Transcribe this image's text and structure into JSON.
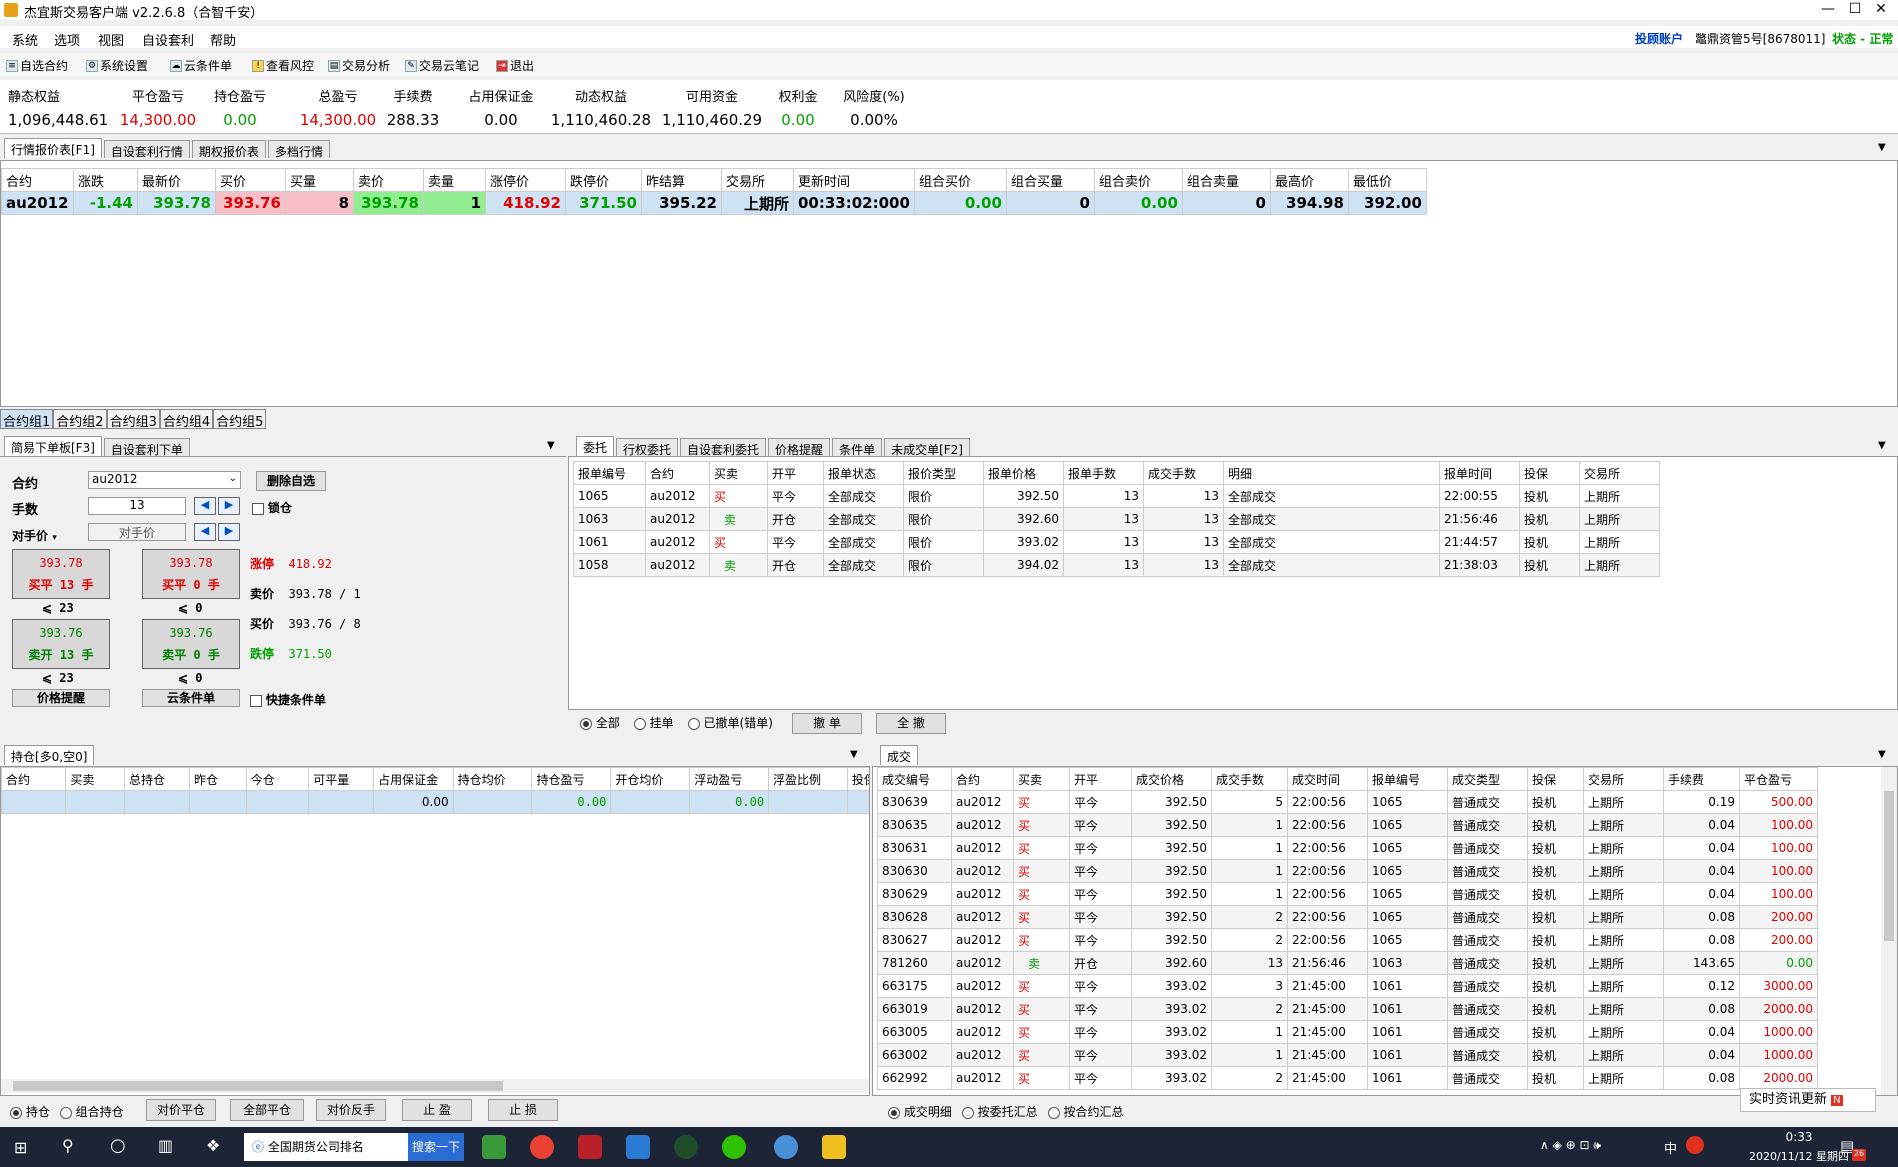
{
  "window": {
    "title": "杰宜斯交易客户端 v2.2.6.8（合智千安）",
    "min": "—",
    "max": "☐",
    "close": "✕"
  },
  "menu": [
    "系统",
    "选项",
    "视图",
    "自设套利",
    "帮助"
  ],
  "account": {
    "type": "投顾账户",
    "name": "鼈鼎资管5号[8678011]",
    "status": "状态 - 正常"
  },
  "toolbar": [
    "自选合约",
    "系统设置",
    "云条件单",
    "查看风控",
    "交易分析",
    "交易云笔记",
    "退出"
  ],
  "summary": [
    {
      "label": "静态权益",
      "value": "1,096,448.61",
      "color": "#000000"
    },
    {
      "label": "平仓盈亏",
      "value": "14,300.00",
      "color": "#e00000"
    },
    {
      "label": "持仓盈亏",
      "value": "0.00",
      "color": "#00a000"
    },
    {
      "label": "总盈亏",
      "value": "14,300.00",
      "color": "#e00000"
    },
    {
      "label": "手续费",
      "value": "288.33",
      "color": "#000000"
    },
    {
      "label": "占用保证金",
      "value": "0.00",
      "color": "#000000"
    },
    {
      "label": "动态权益",
      "value": "1,110,460.28",
      "color": "#000000"
    },
    {
      "label": "可用资金",
      "value": "1,110,460.29",
      "color": "#000000"
    },
    {
      "label": "权利金",
      "value": "0.00",
      "color": "#00a000"
    },
    {
      "label": "风险度(%)",
      "value": "0.00%",
      "color": "#000000"
    }
  ],
  "quote_tabs": [
    "行情报价表[F1]",
    "自设套利行情",
    "期权报价表",
    "多档行情"
  ],
  "quote_headers": [
    "合约",
    "涨跌",
    "最新价",
    "买价",
    "买量",
    "卖价",
    "卖量",
    "涨停价",
    "跌停价",
    "昨结算",
    "交易所",
    "更新时间",
    "组合买价",
    "组合买量",
    "组合卖价",
    "组合卖量",
    "最高价",
    "最低价"
  ],
  "quote_row": [
    "au2012",
    "-1.44",
    "393.78",
    "393.76",
    "8",
    "393.78",
    "1",
    "418.92",
    "371.50",
    "395.22",
    "上期所",
    "00:33:02:000",
    "0.00",
    "0",
    "0.00",
    "0",
    "394.98",
    "392.00"
  ],
  "group_tabs": [
    "合约组1",
    "合约组2",
    "合约组3",
    "合约组4",
    "合约组5"
  ],
  "order_panel": {
    "tabs": [
      "简易下单板[F3]",
      "自设套利下单"
    ],
    "contract_label": "合约",
    "contract_value": "au2012",
    "delete_btn": "删除自选",
    "qty_label": "手数",
    "qty_value": "13",
    "lock_label": "锁仓",
    "price_label": "对手价",
    "price_value": "对手价",
    "buy_close_price": "393.78",
    "buy_close_label": "买平 13 手",
    "buy_close_qty": "23",
    "buy_open_price": "393.78",
    "buy_open_label": "买平 0 手",
    "buy_open_qty": "0",
    "sell_open_price": "393.76",
    "sell_open_label": "卖开 13 手",
    "sell_open_qty": "23",
    "sell_close_price": "393.76",
    "sell_close_label": "卖平 0 手",
    "sell_close_qty": "0",
    "limit_up_label": "涨停",
    "limit_up_value": "418.92",
    "ask_label": "卖价",
    "ask_value": "393.78 / 1",
    "bid_label": "买价",
    "bid_value": "393.76 / 8",
    "limit_down_label": "跌停",
    "limit_down_value": "371.50",
    "price_alert_btn": "价格提醒",
    "cloud_btn": "云条件单",
    "quick_label": "快捷条件单"
  },
  "orders": {
    "tabs": [
      "委托",
      "行权委托",
      "自设套利委托",
      "价格提醒",
      "条件单",
      "未成交单[F2]"
    ],
    "headers": [
      "报单编号",
      "合约",
      "买卖",
      "开平",
      "报单状态",
      "报价类型",
      "报单价格",
      "报单手数",
      "成交手数",
      "明细",
      "报单时间",
      "投保",
      "交易所"
    ],
    "rows": [
      [
        "1065",
        "au2012",
        "买",
        "平今",
        "全部成交",
        "限价",
        "392.50",
        "13",
        "13",
        "全部成交",
        "22:00:55",
        "投机",
        "上期所"
      ],
      [
        "1063",
        "au2012",
        "卖",
        "开仓",
        "全部成交",
        "限价",
        "392.60",
        "13",
        "13",
        "全部成交",
        "21:56:46",
        "投机",
        "上期所"
      ],
      [
        "1061",
        "au2012",
        "买",
        "平今",
        "全部成交",
        "限价",
        "393.02",
        "13",
        "13",
        "全部成交",
        "21:44:57",
        "投机",
        "上期所"
      ],
      [
        "1058",
        "au2012",
        "卖",
        "开仓",
        "全部成交",
        "限价",
        "394.02",
        "13",
        "13",
        "全部成交",
        "21:38:03",
        "投机",
        "上期所"
      ]
    ],
    "filters": [
      "全部",
      "挂单",
      "已撤单(错单)"
    ],
    "cancel_btn": "撤 单",
    "cancel_all_btn": "全 撤"
  },
  "positions": {
    "tab": "持仓[多0,空0]",
    "headers": [
      "合约",
      "买卖",
      "总持仓",
      "昨仓",
      "今仓",
      "可平量",
      "占用保证金",
      "持仓均价",
      "持仓盈亏",
      "开仓均价",
      "浮动盈亏",
      "浮盈比例",
      "投保"
    ],
    "row": [
      "",
      "",
      "",
      "",
      "",
      "",
      "0.00",
      "",
      "0.00",
      "",
      "0.00",
      "",
      ""
    ],
    "radios": [
      "持仓",
      "组合持仓"
    ],
    "buttons": [
      "对价平仓",
      "全部平仓",
      "对价反手",
      "止 盈",
      "止 损"
    ]
  },
  "trades": {
    "tab": "成交",
    "headers": [
      "成交编号",
      "合约",
      "买卖",
      "开平",
      "成交价格",
      "成交手数",
      "成交时间",
      "报单编号",
      "成交类型",
      "投保",
      "交易所",
      "手续费",
      "平仓盈亏"
    ],
    "rows": [
      [
        "830639",
        "au2012",
        "买",
        "平今",
        "392.50",
        "5",
        "22:00:56",
        "1065",
        "普通成交",
        "投机",
        "上期所",
        "0.19",
        "500.00"
      ],
      [
        "830635",
        "au2012",
        "买",
        "平今",
        "392.50",
        "1",
        "22:00:56",
        "1065",
        "普通成交",
        "投机",
        "上期所",
        "0.04",
        "100.00"
      ],
      [
        "830631",
        "au2012",
        "买",
        "平今",
        "392.50",
        "1",
        "22:00:56",
        "1065",
        "普通成交",
        "投机",
        "上期所",
        "0.04",
        "100.00"
      ],
      [
        "830630",
        "au2012",
        "买",
        "平今",
        "392.50",
        "1",
        "22:00:56",
        "1065",
        "普通成交",
        "投机",
        "上期所",
        "0.04",
        "100.00"
      ],
      [
        "830629",
        "au2012",
        "买",
        "平今",
        "392.50",
        "1",
        "22:00:56",
        "1065",
        "普通成交",
        "投机",
        "上期所",
        "0.04",
        "100.00"
      ],
      [
        "830628",
        "au2012",
        "买",
        "平今",
        "392.50",
        "2",
        "22:00:56",
        "1065",
        "普通成交",
        "投机",
        "上期所",
        "0.08",
        "200.00"
      ],
      [
        "830627",
        "au2012",
        "买",
        "平今",
        "392.50",
        "2",
        "22:00:56",
        "1065",
        "普通成交",
        "投机",
        "上期所",
        "0.08",
        "200.00"
      ],
      [
        "781260",
        "au2012",
        "卖",
        "开仓",
        "392.60",
        "13",
        "21:56:46",
        "1063",
        "普通成交",
        "投机",
        "上期所",
        "143.65",
        "0.00"
      ],
      [
        "663175",
        "au2012",
        "买",
        "平今",
        "393.02",
        "3",
        "21:45:00",
        "1061",
        "普通成交",
        "投机",
        "上期所",
        "0.12",
        "3000.00"
      ],
      [
        "663019",
        "au2012",
        "买",
        "平今",
        "393.02",
        "2",
        "21:45:00",
        "1061",
        "普通成交",
        "投机",
        "上期所",
        "0.08",
        "2000.00"
      ],
      [
        "663005",
        "au2012",
        "买",
        "平今",
        "393.02",
        "1",
        "21:45:00",
        "1061",
        "普通成交",
        "投机",
        "上期所",
        "0.04",
        "1000.00"
      ],
      [
        "663002",
        "au2012",
        "买",
        "平今",
        "393.02",
        "1",
        "21:45:00",
        "1061",
        "普通成交",
        "投机",
        "上期所",
        "0.04",
        "1000.00"
      ],
      [
        "662992",
        "au2012",
        "买",
        "平今",
        "393.02",
        "2",
        "21:45:00",
        "1061",
        "普通成交",
        "投机",
        "上期所",
        "0.08",
        "2000.00"
      ]
    ],
    "radios": [
      "成交明细",
      "按委托汇总",
      "按合约汇总"
    ]
  },
  "news_popup": "实时资讯更新",
  "taskbar": {
    "search_label": "全国期货公司排名",
    "search_btn": "搜索一下",
    "time": "0:33",
    "date": "2020/11/12 星期四",
    "ime": "中",
    "badge": "26"
  }
}
